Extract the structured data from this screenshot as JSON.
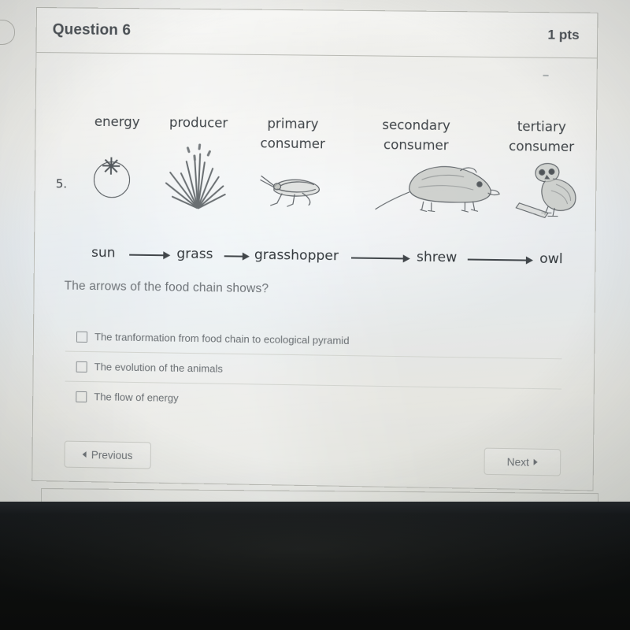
{
  "screen": {
    "question_card": {
      "title": "Question 6",
      "points": "1 pts"
    },
    "figure": {
      "item_number": "5.",
      "trophic_labels": [
        {
          "line1": "energy",
          "line2": ""
        },
        {
          "line1": "producer",
          "line2": ""
        },
        {
          "line1": "primary",
          "line2": "consumer"
        },
        {
          "line1": "secondary",
          "line2": "consumer"
        },
        {
          "line1": "tertiary",
          "line2": "consumer"
        }
      ],
      "chain_nodes": [
        "sun",
        "grass",
        "grasshopper",
        "shrew",
        "owl"
      ],
      "illustrations": [
        "sun-drawing",
        "grass-drawing",
        "grasshopper-drawing",
        "shrew-drawing",
        "owl-drawing"
      ]
    },
    "question_text": "The arrows of the food chain shows?",
    "answers": [
      {
        "label": "The tranformation from food chain to ecological pyramid",
        "checked": false
      },
      {
        "label": "The evolution of the animals",
        "checked": false
      },
      {
        "label": "The flow of energy",
        "checked": false
      }
    ],
    "navigation": {
      "previous": "Previous",
      "next": "Next"
    }
  },
  "colors": {
    "text_dark": "#4a4f54",
    "text_muted": "#6a6f73",
    "card_border": "#b9bab4",
    "screen_bg": "#e6e6e2",
    "photo_band": "#0d0f0f"
  }
}
